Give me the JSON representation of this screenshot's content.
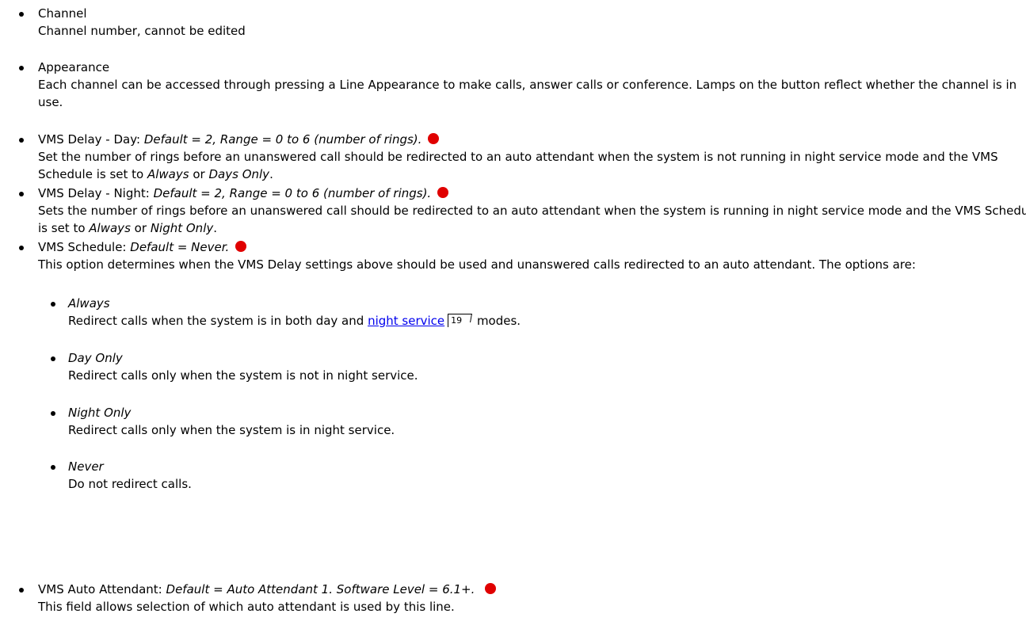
{
  "colors": {
    "link": "#0000ee",
    "marker": "#e00000"
  },
  "items": [
    {
      "head": "Channel",
      "desc": "Channel number, cannot be edited"
    },
    {
      "head": "Appearance",
      "desc": "Each channel can be accessed through pressing a Line Appearance to make calls, answer calls or conference. Lamps on the button reflect whether the channel is in use."
    },
    {
      "head": "VMS Delay - Day:",
      "val": "Default = 2, Range = 0 to 6 (number of rings).",
      "desc": "Set the number of rings before an unanswered call should be redirected to an auto attendant when the system is not running in night service mode and the VMS Schedule is set to",
      "opt1": "Always",
      "or": "or",
      "opt2": "Days Only",
      "end": "."
    },
    {
      "head": "VMS Delay - Night:",
      "val": "Default = 2, Range = 0 to 6 (number of rings).",
      "desc": "Sets the number of rings before an unanswered call should be redirected to an auto attendant when the system is running in night service mode and the VMS Schedule is set to",
      "opt1": "Always",
      "or": "or",
      "opt2": "Night Only",
      "end": "."
    },
    {
      "head": "VMS Schedule:",
      "val": "Default = Never.",
      "desc": "This option determines when the VMS Delay settings above should be used and unanswered calls redirected to an auto attendant. The options are:",
      "sub": [
        {
          "name": "Always",
          "pre": "Redirect calls when the system is in both day and",
          "link": "night service",
          "ref": "19",
          "post": "modes."
        },
        {
          "name": "Day Only",
          "desc": "Redirect calls only when the system is not in night service."
        },
        {
          "name": "Night Only",
          "desc": "Redirect calls only when the system is in night service."
        },
        {
          "name": "Never",
          "desc": "Do not redirect calls."
        }
      ]
    },
    {
      "head": "VMS Auto Attendant:",
      "val": "Default = Auto Attendant 1. Software Level = 6.1+.",
      "desc": "This field allows selection of which auto attendant is used by this line."
    }
  ]
}
